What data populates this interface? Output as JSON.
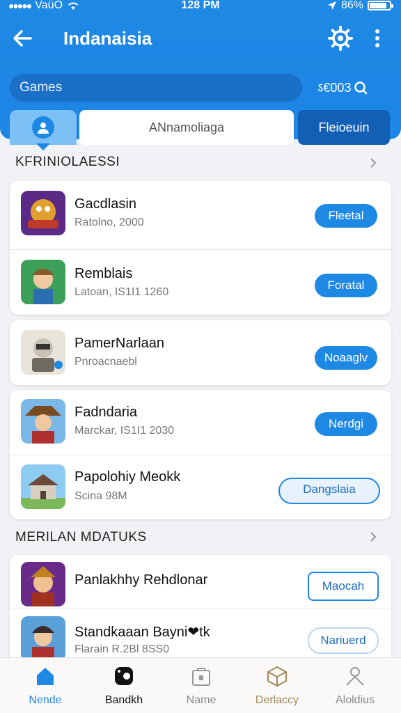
{
  "status_bar": {
    "carrier": "VaüO",
    "time": "128 PM",
    "battery": "86%",
    "battery_level": 0.86
  },
  "header": {
    "title": "Indanaisia",
    "search_placeholder": "Games",
    "search_right": "ऽ€003",
    "middle_field": "ANnamoliaga",
    "action_button": "Fleioeuin"
  },
  "sections": [
    {
      "title": "KFRINIOLAESSI",
      "items": [
        {
          "name": "Gacdlasin",
          "sub": "Ratolno, 2000",
          "button": "Fleetal"
        },
        {
          "name": "Remblais",
          "sub": "Latoan, IS1I1 1260",
          "button": "Foratal"
        },
        {
          "name": "PamerNarlaan",
          "sub": "Pnroacnaebl",
          "button": "Noaaglv"
        },
        {
          "name": "Fadndaria",
          "sub": "Marckar, IS1I1 2030",
          "button": "Nerdgi"
        },
        {
          "name": "Papolohiy Meokk",
          "sub": "Scina 98M",
          "button": "Dangslaia"
        }
      ]
    },
    {
      "title": "MERILAN MDATUKS",
      "items": [
        {
          "name": "Panlakhhy Rehdlonar",
          "sub": "",
          "button": "Maocah"
        },
        {
          "name": "Standkaaan Bayni❤tk",
          "sub": "Flarain R.2Bl 8SS0",
          "button": "Nariuerd"
        }
      ]
    }
  ],
  "tab_bar": [
    {
      "label": "Nende",
      "icon": "home-icon",
      "active": true
    },
    {
      "label": "Bandkh",
      "icon": "gamepad-icon",
      "active": false
    },
    {
      "label": "Name",
      "icon": "bag-icon",
      "active": false
    },
    {
      "label": "Derlaccy",
      "icon": "box-icon",
      "active": false
    },
    {
      "label": "Aloldius",
      "icon": "person-icon",
      "active": false
    }
  ],
  "colors": {
    "primary": "#1e88e5",
    "primary_dark": "#135fb6",
    "background": "#f1f2f5"
  }
}
